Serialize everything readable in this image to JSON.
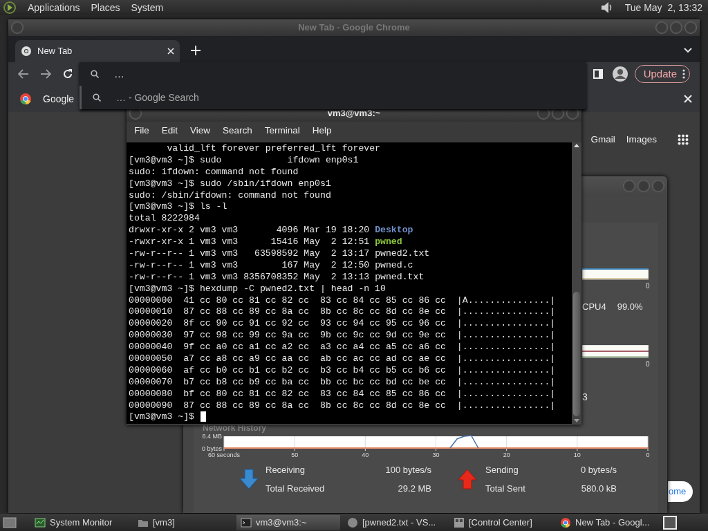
{
  "top_panel": {
    "menus": [
      "Applications",
      "Places",
      "System"
    ],
    "clock": "Tue May  2, 13:32"
  },
  "chrome": {
    "title": "New Tab - Google Chrome",
    "tabs": [
      {
        "label": "New Tab",
        "selected": true
      }
    ],
    "omnibox": {
      "value": "…",
      "suggestion": "… - Google Search"
    },
    "update_button": "Update",
    "bookmarks": [
      "Google"
    ],
    "links": [
      "Gmail",
      "Images"
    ],
    "customize_button": "ome"
  },
  "system_monitor": {
    "cpu_axis_label": "0",
    "cpu_label": "CPU4",
    "cpu_value": "99.0%",
    "memory_axis_label": "0",
    "memory_fragment": "3",
    "network": {
      "title": "Network History",
      "chart_data": {
        "type": "line",
        "x": [
          60,
          50,
          40,
          30,
          28,
          27,
          26,
          25,
          24,
          20,
          10,
          0
        ],
        "series": [
          {
            "color": "#e06a3a",
            "values": [
              0,
              0,
              0,
              0,
              0,
              0,
              0,
              0,
              0,
              0,
              0,
              0
            ]
          },
          {
            "color": "#4a6fa5",
            "values": [
              null,
              null,
              null,
              null,
              0,
              6.2,
              7.9,
              8.4,
              0,
              null,
              null,
              null
            ]
          }
        ],
        "grid": true,
        "xlim": [
          60,
          0
        ],
        "ylim": [
          0,
          8.4
        ],
        "xticks": [
          {
            "value": 60,
            "label": "60 seconds"
          },
          50,
          40,
          30,
          20,
          10,
          0
        ],
        "yticks": [
          {
            "value": 8.4,
            "label": "8.4 MB"
          },
          {
            "value": 0,
            "label": "0 bytes"
          }
        ]
      },
      "receiving": {
        "label": "Receiving",
        "value": "100 bytes/s",
        "total_label": "Total Received",
        "total": "29.2 MB"
      },
      "sending": {
        "label": "Sending",
        "value": "0 bytes/s",
        "total_label": "Total Sent",
        "total": "580.0 kB"
      }
    }
  },
  "terminal": {
    "title": "vm3@vm3:~",
    "menus": [
      "File",
      "Edit",
      "View",
      "Search",
      "Terminal",
      "Help"
    ],
    "lines": [
      {
        "text": "       valid_lft forever preferred_lft forever"
      },
      {
        "text": "[vm3@vm3 ~]$ sudo            ifdown enp0s1"
      },
      {
        "text": "sudo: ifdown: command not found"
      },
      {
        "text": "[vm3@vm3 ~]$ sudo /sbin/ifdown enp0s1"
      },
      {
        "text": "sudo: /sbin/ifdown: command not found"
      },
      {
        "text": "[vm3@vm3 ~]$ ls -l"
      },
      {
        "text": "total 8222984"
      },
      {
        "text": "drwxr-xr-x 2 vm3 vm3       4096 Mar 19 18:20 ",
        "file": "Desktop",
        "kind": "dir"
      },
      {
        "text": "-rwxr-xr-x 1 vm3 vm3      15416 May  2 12:51 ",
        "file": "pwned",
        "kind": "exec"
      },
      {
        "text": "-rw-r--r-- 1 vm3 vm3   63598592 May  2 13:17 ",
        "file": "pwned2.txt",
        "kind": "plain"
      },
      {
        "text": "-rw-r--r-- 1 vm3 vm3        167 May  2 12:50 ",
        "file": "pwned.c",
        "kind": "plain"
      },
      {
        "text": "-rw-r--r-- 1 vm3 vm3 8356708352 May  2 13:13 ",
        "file": "pwned.txt",
        "kind": "plain"
      },
      {
        "text": "[vm3@vm3 ~]$ hexdump -C pwned2.txt | head -n 10"
      },
      {
        "text": "00000000  41 cc 80 cc 81 cc 82 cc  83 cc 84 cc 85 cc 86 cc  |A...............|"
      },
      {
        "text": "00000010  87 cc 88 cc 89 cc 8a cc  8b cc 8c cc 8d cc 8e cc  |................|"
      },
      {
        "text": "00000020  8f cc 90 cc 91 cc 92 cc  93 cc 94 cc 95 cc 96 cc  |................|"
      },
      {
        "text": "00000030  97 cc 98 cc 99 cc 9a cc  9b cc 9c cc 9d cc 9e cc  |................|"
      },
      {
        "text": "00000040  9f cc a0 cc a1 cc a2 cc  a3 cc a4 cc a5 cc a6 cc  |................|"
      },
      {
        "text": "00000050  a7 cc a8 cc a9 cc aa cc  ab cc ac cc ad cc ae cc  |................|"
      },
      {
        "text": "00000060  af cc b0 cc b1 cc b2 cc  b3 cc b4 cc b5 cc b6 cc  |................|"
      },
      {
        "text": "00000070  b7 cc b8 cc b9 cc ba cc  bb cc bc cc bd cc be cc  |................|"
      },
      {
        "text": "00000080  bf cc 80 cc 81 cc 82 cc  83 cc 84 cc 85 cc 86 cc  |................|"
      },
      {
        "text": "00000090  87 cc 88 cc 89 cc 8a cc  8b cc 8c cc 8d cc 8e cc  |................|"
      }
    ],
    "prompt": "[vm3@vm3 ~]$ "
  },
  "taskbar": [
    {
      "label": "System Monitor",
      "kind": "monitor",
      "selected": false
    },
    {
      "label": "[vm3]",
      "kind": "folder",
      "selected": false
    },
    {
      "label": "vm3@vm3:~",
      "kind": "terminal",
      "selected": true
    },
    {
      "label": "[pwned2.txt - VS...",
      "kind": "editor",
      "selected": false
    },
    {
      "label": "[Control Center]",
      "kind": "control",
      "selected": false
    },
    {
      "label": "New Tab - Googl...",
      "kind": "browser",
      "selected": false
    }
  ]
}
